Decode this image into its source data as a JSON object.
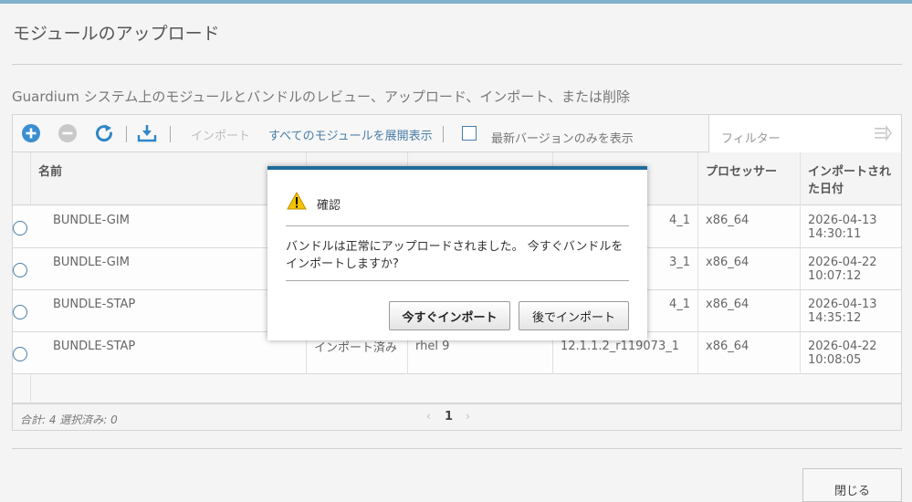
{
  "colors": {
    "accent": "#2f87c8",
    "dialog_bar": "#1e6b9a",
    "warning": "#f5c400"
  },
  "page": {
    "title": "モジュールのアップロード",
    "description": "Guardium システム上のモジュールとバンドルのレビュー、アップロード、インポート、または削除"
  },
  "toolbar": {
    "add_icon": "plus-circle-icon",
    "remove_icon": "minus-circle-icon",
    "refresh_icon": "refresh-icon",
    "upload_icon": "download-tray-icon",
    "import_label": "インポート",
    "expand_all_label": "すべてのモジュールを展開表示",
    "latest_only_label": "最新バージョンのみを表示",
    "filter_placeholder": "フィルター",
    "filter_icon": "filter-list-icon"
  },
  "table": {
    "columns": [
      {
        "label": "名前"
      },
      {
        "label": ""
      },
      {
        "label": ""
      },
      {
        "label": ""
      },
      {
        "label": "プロセッサー"
      },
      {
        "label": "インポートされた日付"
      }
    ],
    "rows": [
      {
        "name": "BUNDLE-GIM",
        "status": "",
        "os": "",
        "version": "4_1",
        "processor": "x86_64",
        "date": "2026-04-13 14:30:11"
      },
      {
        "name": "BUNDLE-GIM",
        "status": "",
        "os": "",
        "version": "3_1",
        "processor": "x86_64",
        "date": "2026-04-22 10:07:12"
      },
      {
        "name": "BUNDLE-STAP",
        "status": "",
        "os": "",
        "version": "4_1",
        "processor": "x86_64",
        "date": "2026-04-13 14:35:12"
      },
      {
        "name": "BUNDLE-STAP",
        "status": "インポート済み",
        "os": "rhel 9",
        "version": "12.1.1.2_r119073_1",
        "processor": "x86_64",
        "date": "2026-04-22 10:08:05"
      }
    ]
  },
  "footer": {
    "summary": "合計: 4 選択済み: 0",
    "prev": "‹",
    "page": "1",
    "next": "›"
  },
  "close_label": "閉じる",
  "dialog": {
    "icon": "warning-icon",
    "title": "確認",
    "message": "バンドルは正常にアップロードされました。 今すぐバンドルをインポートしますか?",
    "import_now_label": "今すぐインポート",
    "import_later_label": "後でインポート"
  }
}
